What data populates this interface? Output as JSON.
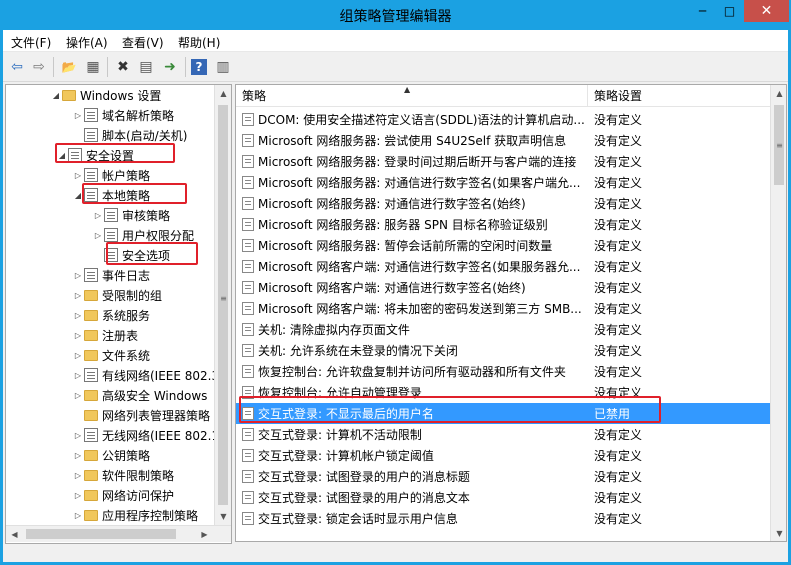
{
  "window": {
    "title": "组策略管理编辑器",
    "minimize_glyph": "─",
    "maximize_glyph": "□",
    "close_glyph": "✕"
  },
  "menu": [
    "文件(F)",
    "操作(A)",
    "查看(V)",
    "帮助(H)"
  ],
  "toolbar": {
    "icons": [
      "back-arrow-icon",
      "forward-arrow-icon",
      "up-folder-icon",
      "show-hide-tree-icon",
      "delete-icon",
      "properties-icon",
      "export-list-icon",
      "help-icon",
      "console-view-icon"
    ],
    "glyphs": [
      "⇦",
      "⇨",
      "📂",
      "▦",
      "✖",
      "▤",
      "➜",
      "?",
      "▥"
    ]
  },
  "tree": [
    {
      "label": "Windows 设置",
      "arrow": "◢",
      "icon": "folder"
    },
    {
      "label": "域名解析策略",
      "arrow": "▷",
      "icon": "policy"
    },
    {
      "label": "脚本(启动/关机)",
      "arrow": "",
      "icon": "policy"
    },
    {
      "label": "安全设置",
      "arrow": "◢",
      "icon": "policy"
    },
    {
      "label": "帐户策略",
      "arrow": "▷",
      "icon": "policy"
    },
    {
      "label": "本地策略",
      "arrow": "◢",
      "icon": "policy"
    },
    {
      "label": "审核策略",
      "arrow": "▷",
      "icon": "policy"
    },
    {
      "label": "用户权限分配",
      "arrow": "▷",
      "icon": "policy"
    },
    {
      "label": "安全选项",
      "arrow": "",
      "icon": "policy"
    },
    {
      "label": "事件日志",
      "arrow": "▷",
      "icon": "policy"
    },
    {
      "label": "受限制的组",
      "arrow": "▷",
      "icon": "folder"
    },
    {
      "label": "系统服务",
      "arrow": "▷",
      "icon": "folder"
    },
    {
      "label": "注册表",
      "arrow": "▷",
      "icon": "folder"
    },
    {
      "label": "文件系统",
      "arrow": "▷",
      "icon": "folder"
    },
    {
      "label": "有线网络(IEEE 802.3)",
      "arrow": "▷",
      "icon": "policy"
    },
    {
      "label": "高级安全 Windows",
      "arrow": "▷",
      "icon": "folder"
    },
    {
      "label": "网络列表管理器策略",
      "arrow": "",
      "icon": "folder"
    },
    {
      "label": "无线网络(IEEE 802.11)",
      "arrow": "▷",
      "icon": "policy"
    },
    {
      "label": "公钥策略",
      "arrow": "▷",
      "icon": "folder"
    },
    {
      "label": "软件限制策略",
      "arrow": "▷",
      "icon": "folder"
    },
    {
      "label": "网络访问保护",
      "arrow": "▷",
      "icon": "folder"
    },
    {
      "label": "应用程序控制策略",
      "arrow": "▷",
      "icon": "folder"
    }
  ],
  "list": {
    "columns": [
      "策略",
      "策略设置"
    ],
    "rows": [
      {
        "policy": "DCOM: 使用安全描述符定义语言(SDDL)语法的计算机启动...",
        "setting": "没有定义"
      },
      {
        "policy": "Microsoft 网络服务器: 尝试使用 S4U2Self 获取声明信息",
        "setting": "没有定义"
      },
      {
        "policy": "Microsoft 网络服务器: 登录时间过期后断开与客户端的连接",
        "setting": "没有定义"
      },
      {
        "policy": "Microsoft 网络服务器: 对通信进行数字签名(如果客户端允...",
        "setting": "没有定义"
      },
      {
        "policy": "Microsoft 网络服务器: 对通信进行数字签名(始终)",
        "setting": "没有定义"
      },
      {
        "policy": "Microsoft 网络服务器: 服务器 SPN 目标名称验证级别",
        "setting": "没有定义"
      },
      {
        "policy": "Microsoft 网络服务器: 暂停会话前所需的空闲时间数量",
        "setting": "没有定义"
      },
      {
        "policy": "Microsoft 网络客户端: 对通信进行数字签名(如果服务器允...",
        "setting": "没有定义"
      },
      {
        "policy": "Microsoft 网络客户端: 对通信进行数字签名(始终)",
        "setting": "没有定义"
      },
      {
        "policy": "Microsoft 网络客户端: 将未加密的密码发送到第三方 SMB...",
        "setting": "没有定义"
      },
      {
        "policy": "关机: 清除虚拟内存页面文件",
        "setting": "没有定义"
      },
      {
        "policy": "关机: 允许系统在未登录的情况下关闭",
        "setting": "没有定义"
      },
      {
        "policy": "恢复控制台: 允许软盘复制并访问所有驱动器和所有文件夹",
        "setting": "没有定义"
      },
      {
        "policy": "恢复控制台: 允许自动管理登录",
        "setting": "没有定义"
      },
      {
        "policy": "交互式登录: 不显示最后的用户名",
        "setting": "已禁用"
      },
      {
        "policy": "交互式登录: 计算机不活动限制",
        "setting": "没有定义"
      },
      {
        "policy": "交互式登录: 计算机帐户锁定阈值",
        "setting": "没有定义"
      },
      {
        "policy": "交互式登录: 试图登录的用户的消息标题",
        "setting": "没有定义"
      },
      {
        "policy": "交互式登录: 试图登录的用户的消息文本",
        "setting": "没有定义"
      },
      {
        "policy": "交互式登录: 锁定会话时显示用户信息",
        "setting": "没有定义"
      }
    ],
    "selected_index": 14
  },
  "scroll_glyphs": {
    "up": "▲",
    "down": "▼",
    "left": "◀",
    "right": "▶",
    "grip": "≡"
  },
  "colors": {
    "titlebar": "#1ba1e2",
    "selection": "#3399ff",
    "highlight_box": "#e0202a",
    "close_button": "#c7504a"
  }
}
